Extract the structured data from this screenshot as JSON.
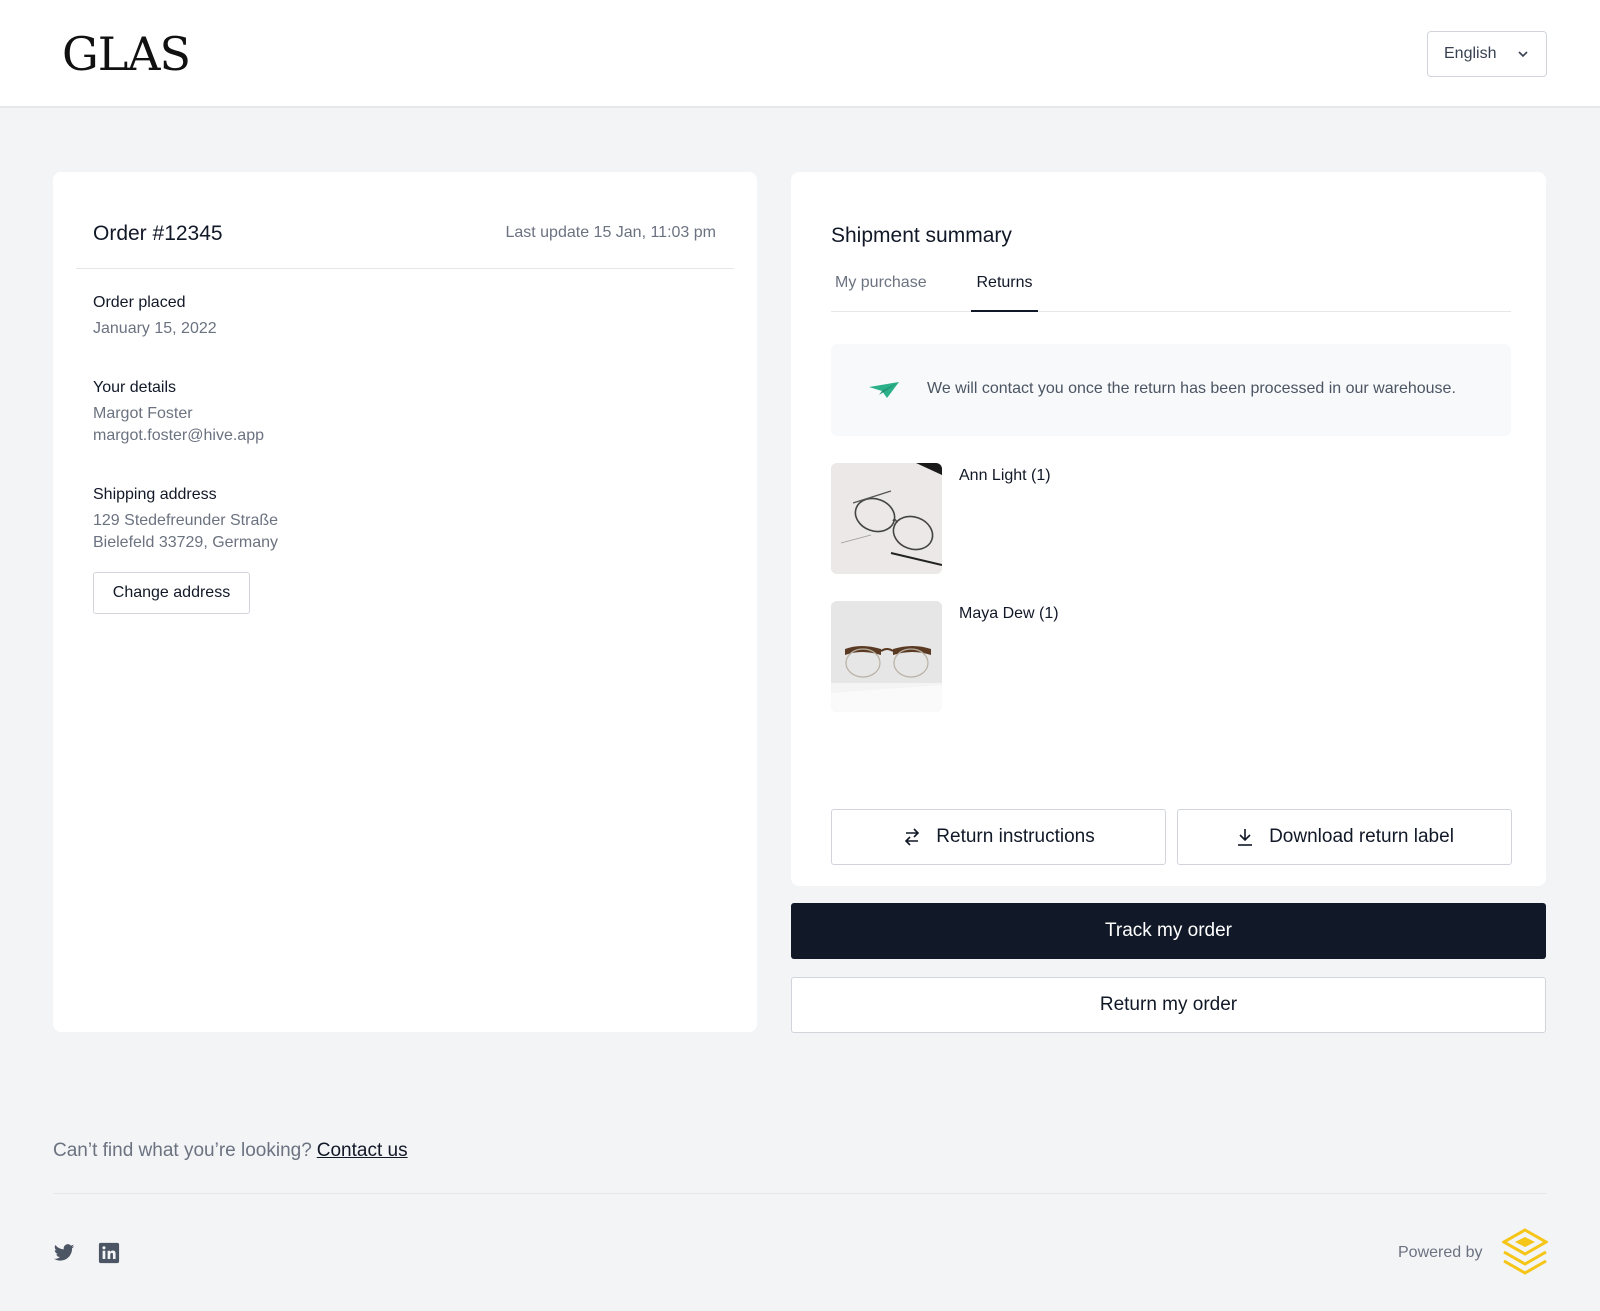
{
  "header": {
    "logo_text": "GLAS",
    "language": "English"
  },
  "order": {
    "title": "Order #12345",
    "last_update": "Last update 15 Jan, 11:03 pm",
    "placed_label": "Order placed",
    "placed_date": "January 15, 2022",
    "details_label": "Your details",
    "customer_name": "Margot Foster",
    "customer_email": "margot.foster@hive.app",
    "shipping_label": "Shipping address",
    "address_line1": "129 Stedefreunder Straße",
    "address_line2": "Bielefeld 33729, Germany",
    "change_address": "Change address"
  },
  "shipment": {
    "title": "Shipment summary",
    "tabs": [
      {
        "label": "My purchase",
        "active": false
      },
      {
        "label": "Returns",
        "active": true
      }
    ],
    "notice": "We will contact you once the return has been processed in our warehouse.",
    "products": [
      {
        "name": "Ann Light (1)"
      },
      {
        "name": "Maya Dew (1)"
      }
    ],
    "return_instructions": "Return instructions",
    "download_label": "Download return label"
  },
  "actions": {
    "track": "Track my order",
    "return": "Return my order"
  },
  "footer": {
    "help_text": "Can’t find what you’re looking?",
    "contact_link": "Contact us",
    "powered_by": "Powered by"
  },
  "colors": {
    "primary_dark": "#111827",
    "notice_icon": "#2bb08a",
    "hive_logo": "#f5c518"
  }
}
